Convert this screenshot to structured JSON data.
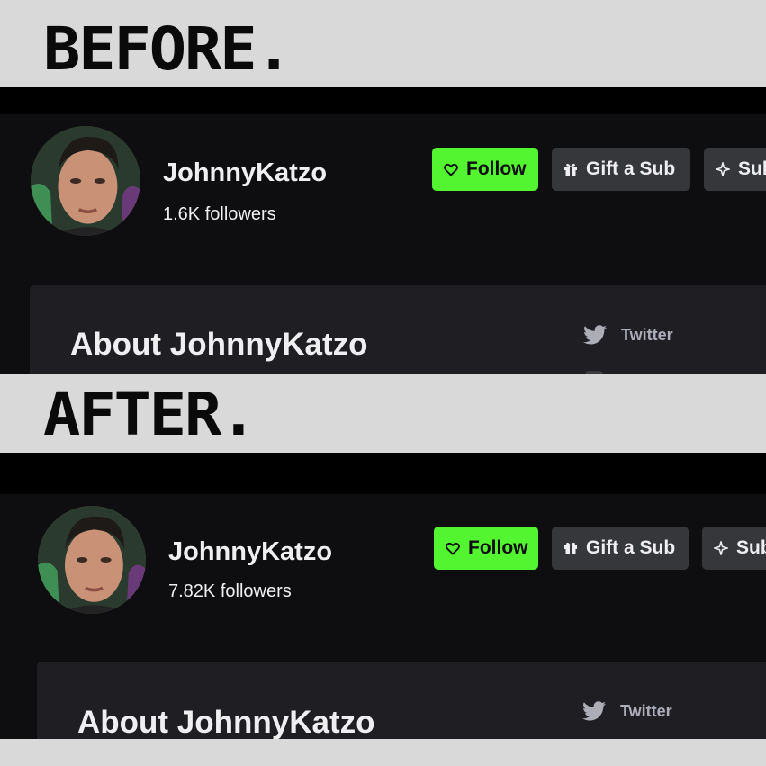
{
  "before": {
    "heading": "BEFORE.",
    "channel_name": "JohnnyKatzo",
    "followers": "1.6K followers",
    "follow_label": "Follow",
    "gift_label": "Gift a Sub",
    "subscribe_label": "Sub",
    "about_title": "About JohnnyKatzo",
    "twitter_label": "Twitter"
  },
  "after": {
    "heading": "AFTER.",
    "channel_name": "JohnnyKatzo",
    "followers": "7.82K followers",
    "follow_label": "Follow",
    "gift_label": "Gift a Sub",
    "subscribe_label": "Sub",
    "about_title": "About JohnnyKatzo",
    "twitter_label": "Twitter"
  },
  "icons": {
    "follow": "heart-icon",
    "gift": "gift-icon",
    "subscribe": "sparkle-icon",
    "twitter": "twitter-bird-icon"
  },
  "colors": {
    "page_background": "#d9d9d9",
    "panel_background": "#0e0e10",
    "card_background": "#1f1f23",
    "follow_button": "#52f530",
    "secondary_button": "#36373b",
    "text": "#efeff1",
    "muted_text": "#adadb8"
  }
}
